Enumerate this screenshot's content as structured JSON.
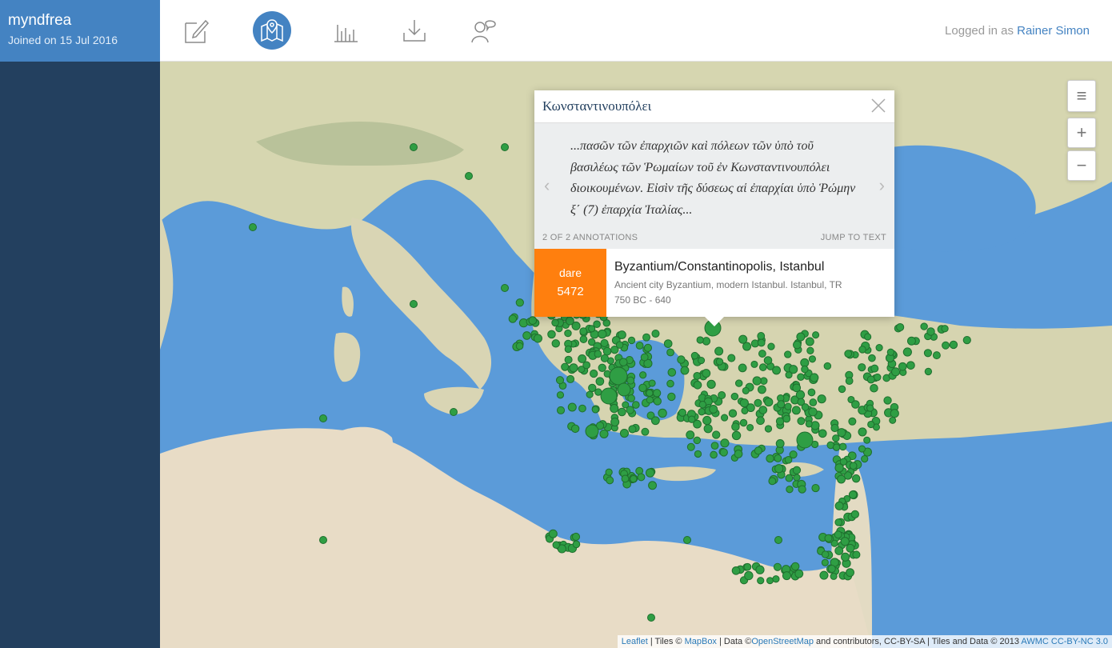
{
  "sidebar": {
    "username": "myndfrea",
    "joined": "Joined on 15 Jul 2016"
  },
  "header": {
    "nav": [
      {
        "name": "edit-icon",
        "active": false
      },
      {
        "name": "map-icon",
        "active": true
      },
      {
        "name": "stats-icon",
        "active": false
      },
      {
        "name": "download-icon",
        "active": false
      },
      {
        "name": "share-users-icon",
        "active": false
      }
    ],
    "login_prefix": "Logged in as",
    "login_user": "Rainer Simon"
  },
  "map": {
    "controls": {
      "layers": "≡",
      "zoom_in": "+",
      "zoom_out": "−"
    },
    "popup": {
      "title": "Κωνσταντινουπόλει",
      "quote": "...πασῶν τῶν ἐπαρχιῶν καὶ πόλεων τῶν ὑπὸ τοῦ βασιλέως τῶν Ῥωμαίων τοῦ ἐν Κωνσταντινουπόλει διοικουμένων. Εἰσὶν τῆς δύσεως αἱ ἐπαρχίαι ὑπὸ Ῥώμην ξ΄ (7) ἐπαρχία Ἰταλίας...",
      "count": "2 OF 2 ANNOTATIONS",
      "jump": "JUMP TO TEXT",
      "badge_source": "dare",
      "badge_id": "5472",
      "place_title": "Byzantium/Constantinopolis, Istanbul",
      "place_desc": "Ancient city Byzantium, modern Istanbul. Istanbul, TR",
      "place_date": "750 BC - 640"
    },
    "attribution": {
      "leaflet": "Leaflet",
      "tiles_prefix": "| Tiles ©",
      "mapbox": "MapBox",
      "data_prefix": "| Data ©",
      "osm": "OpenStreetMap",
      "osm_suffix": "and contributors, CC-BY-SA | Tiles and Data © 2013",
      "awmc": "AWMC CC-BY-NC 3.0"
    }
  },
  "colors": {
    "sidebar": "#23405f",
    "accent": "#4483c2",
    "sea": "#5b9bd9",
    "land": "#e1dcc6",
    "marker": "#2f9e44",
    "badge": "#ff7f0e"
  }
}
